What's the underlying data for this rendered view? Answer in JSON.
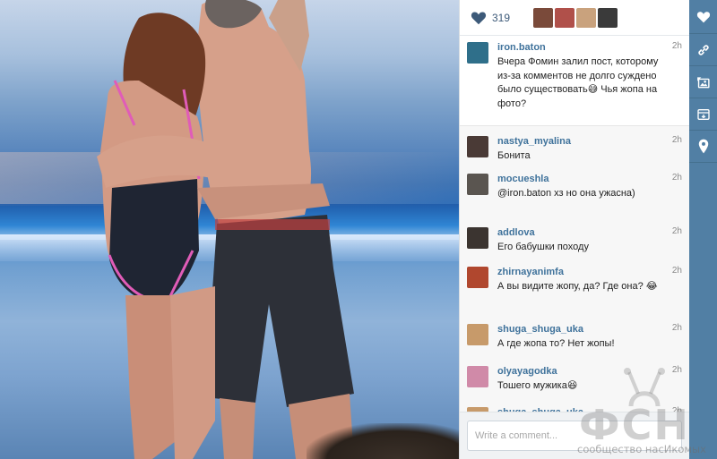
{
  "post": {
    "like_icon": "heart-icon",
    "like_count": "319",
    "likers": [
      {
        "name": "liker-1",
        "color": "#7a4a3a"
      },
      {
        "name": "liker-2",
        "color": "#b0504a"
      },
      {
        "name": "liker-3",
        "color": "#c9a27d"
      },
      {
        "name": "liker-4",
        "color": "#3a3a3a"
      }
    ]
  },
  "comments": [
    {
      "user": "iron.baton",
      "time": "2h",
      "text": "Вчера Фомин залил пост, которому из-за комментов не долго суждено было существовать😅 Чья жопа на фото?",
      "avatar_color": "#2f6f8a"
    },
    {
      "user": "nastya_myalina",
      "time": "2h",
      "text": "Бонита",
      "avatar_color": "#4a3a36"
    },
    {
      "user": "mocueshla",
      "time": "2h",
      "text": "@iron.baton хз но она ужасна)",
      "avatar_color": "#5a5550"
    },
    {
      "user": "addlova",
      "time": "2h",
      "text": "Его бабушки походу",
      "avatar_color": "#3b3430"
    },
    {
      "user": "zhirnayanimfa",
      "time": "2h",
      "text": "А вы видите жопу, да? Где она? 😂",
      "avatar_color": "#b0472e"
    },
    {
      "user": "shuga_shuga_uka",
      "time": "2h",
      "text": "А где жопа то? Нет жопы!",
      "avatar_color": "#c79a6a"
    },
    {
      "user": "olyayagodka",
      "time": "2h",
      "text": "Тошего мужика😆",
      "avatar_color": "#d08aa8"
    },
    {
      "user": "shuga_shuga_uka",
      "time": "2h",
      "text": "",
      "avatar_color": "#c79a6a"
    }
  ],
  "composer": {
    "placeholder": "Write a comment..."
  },
  "sidebar": {
    "buttons": [
      {
        "icon": "heart-icon"
      },
      {
        "icon": "link-icon"
      },
      {
        "icon": "share-image-icon"
      },
      {
        "icon": "archive-icon"
      },
      {
        "icon": "location-pin-icon"
      }
    ]
  },
  "watermark": {
    "logo": "ФСН",
    "tagline": "сообщество насИкомых"
  },
  "colors": {
    "sidebar": "#517fa4",
    "username": "#3f729b",
    "heart": "#3d5a79"
  }
}
